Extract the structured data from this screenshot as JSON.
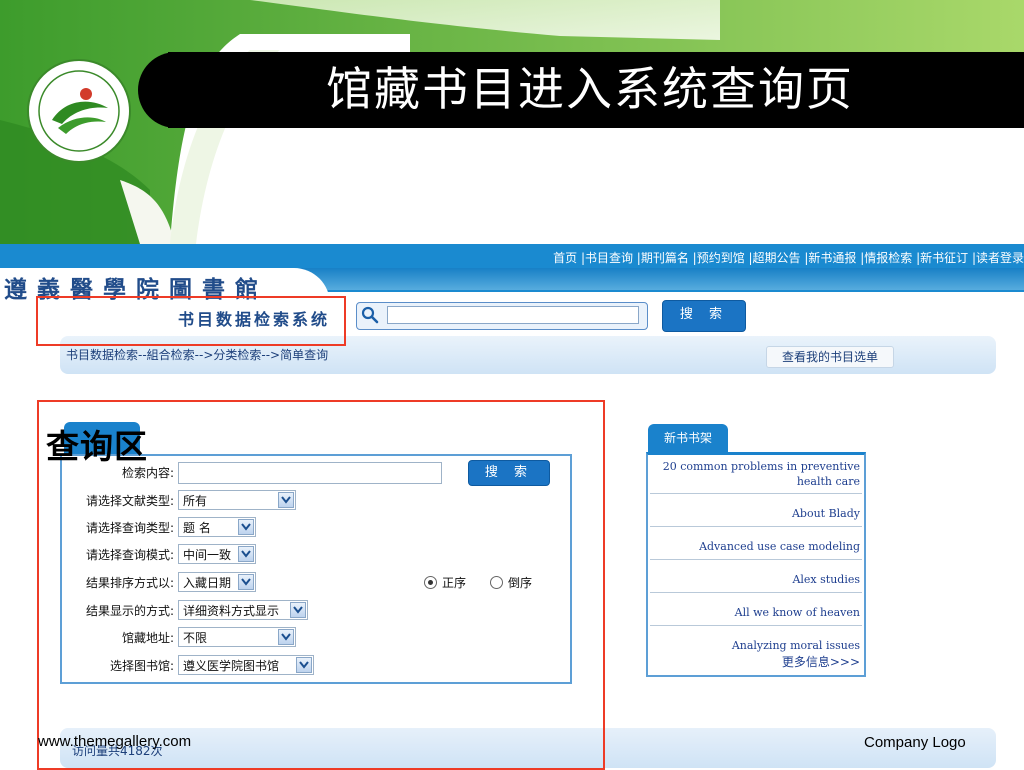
{
  "slide": {
    "title": "馆藏书目进入系统查询页",
    "footer_left": "www.themegallery.com",
    "footer_right": "Company Logo",
    "annotation_label": "查询区"
  },
  "opac": {
    "top_nav": "首页 |书目查询 |期刊篇名 |预约到馆 |超期公告 |新书通报 |情报检索 |新书征订 |读者登录",
    "library_name": "遵義醫學院圖書館",
    "system_name": "书目数据检索系统",
    "search": {
      "value": "",
      "button_label": "搜 索"
    },
    "breadcrumb": "书目数据检索--組合检索-->分类检索-->简单查询",
    "my_list_button": "查看我的书目选单",
    "query": {
      "keyword_label": "检索内容:",
      "keyword_value": "",
      "search_button": "搜 索",
      "fields": [
        {
          "label": "请选择文献类型:",
          "value": "所有"
        },
        {
          "label": "请选择查询类型:",
          "value": "题  名"
        },
        {
          "label": "请选择查询模式:",
          "value": "中间一致"
        },
        {
          "label": "结果排序方式以:",
          "value": "入藏日期"
        },
        {
          "label": "结果显示的方式:",
          "value": "详细资料方式显示"
        },
        {
          "label": "馆藏地址:",
          "value": "不限"
        },
        {
          "label": "选择图书馆:",
          "value": "遵义医学院图书馆"
        }
      ],
      "sort_order": {
        "asc": "正序",
        "desc": "倒序",
        "selected": "asc"
      }
    },
    "new_books": {
      "tab_label": "新书书架",
      "items": [
        "20 common problems in preventive health care",
        "About Blady",
        "Advanced use case modeling",
        "Alex studies",
        "All we know of heaven",
        "Analyzing moral issues"
      ],
      "more_label": "更多信息>>>"
    },
    "visit_count": "访问量共4182次"
  },
  "colors": {
    "accent_blue": "#1a82cc",
    "highlight_red": "#ee3b26",
    "title_bar": "#000000",
    "leaf_green": "#8cc63f"
  }
}
